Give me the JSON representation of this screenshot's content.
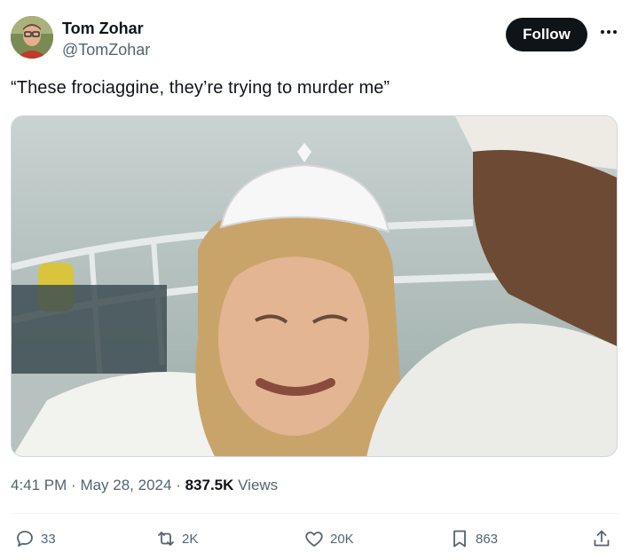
{
  "author": {
    "name": "Tom Zohar",
    "handle": "@TomZohar"
  },
  "follow_label": "Follow",
  "tweet_text": "“These frociaggine, they’re trying to murder me”",
  "meta": {
    "time": "4:41 PM",
    "date": "May 28, 2024",
    "views_count": "837.5K",
    "views_label": "Views"
  },
  "actions": {
    "replies": "33",
    "reposts": "2K",
    "likes": "20K",
    "bookmarks": "863"
  },
  "icons": [
    "more-icon",
    "reply-icon",
    "repost-icon",
    "like-icon",
    "bookmark-icon",
    "share-icon"
  ],
  "colors": {
    "text_primary": "#0f1419",
    "text_secondary": "#536471",
    "follow_bg": "#0f1419"
  }
}
